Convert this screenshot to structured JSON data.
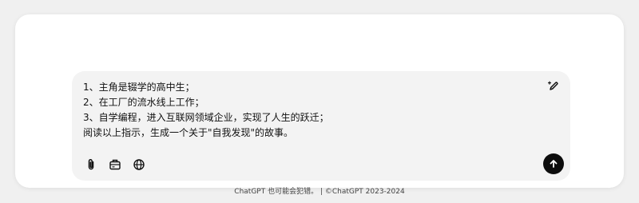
{
  "composer": {
    "lines": [
      "1、主角是辍学的高中生；",
      "2、在工厂的流水线上工作；",
      "3、自学编程，进入互联网领域企业，实现了人生的跃迁；",
      "阅读以上指示，生成一个关于\"自我发现\"的故事。"
    ],
    "icons": {
      "edit": "pencil-sparkle-icon",
      "attach": "paperclip-icon",
      "tools": "briefcase-icon",
      "web": "globe-icon",
      "send": "arrow-up-icon"
    }
  },
  "footer": {
    "disclaimer": "ChatGPT 也可能会犯错。 | ©ChatGPT 2023-2024"
  },
  "colors": {
    "composer_bg": "#f3f3f3",
    "send_bg": "#0d0d0d"
  }
}
